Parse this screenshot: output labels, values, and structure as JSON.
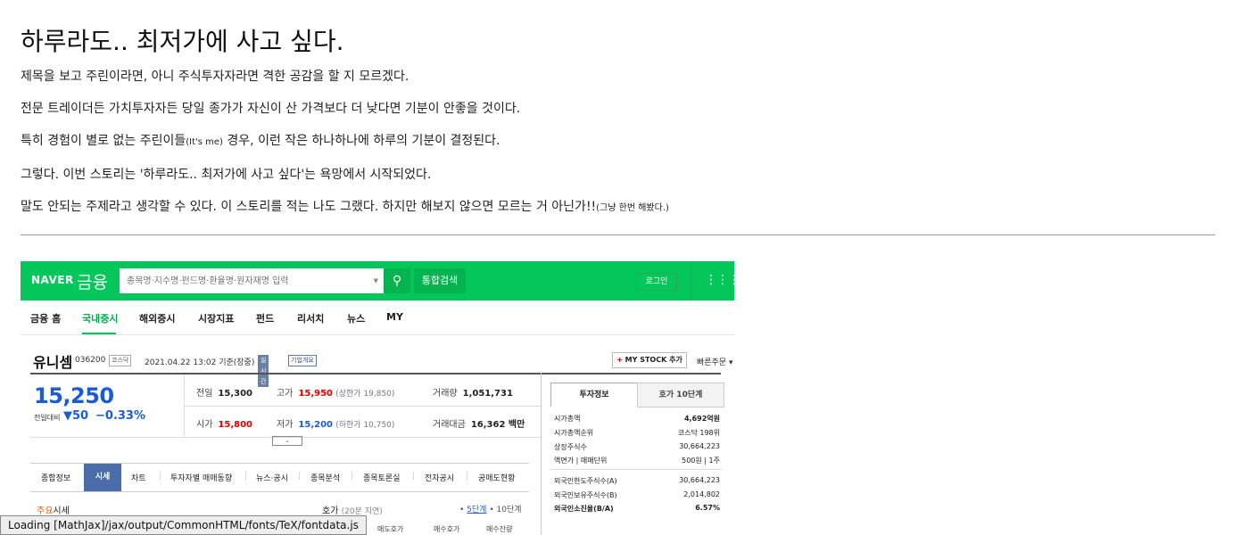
{
  "post": {
    "title": "하루라도.. 최저가에 사고 싶다.",
    "p1": "제목을 보고 주린이라면, 아니 주식투자자라면 격한 공감을 할 지 모르겠다.",
    "p2": "전문 트레이더든 가치투자자든 당일 종가가 자신이 산 가격보다 더 낮다면 기분이 안좋을 것이다.",
    "p3_a": "특히 경험이 별로 없는 주린이들",
    "p3_small": "(It's me)",
    "p3_b": " 경우, 이런 작은 하나하나에 하루의 기분이 결정된다.",
    "p4": "그렇다. 이번 스토리는 '하루라도.. 최저가에 사고 싶다'는 욕망에서 시작되었다.",
    "p5_a": "말도 안되는 주제라고 생각할 수 있다. 이 스토리를 적는 나도 그랬다. 하지만 해보지 않으면 모르는 거 아닌가!!",
    "p5_small": "(그냥 한번 해봤다.)"
  },
  "naver": {
    "logo": "NAVER",
    "service": "금융",
    "search_placeholder": "종목명·지수명·펀드명·환율명·원자재명 입력",
    "total_search": "통합검색",
    "login": "로그인",
    "gnb": [
      "금융 홈",
      "국내증시",
      "해외증시",
      "시장지표",
      "펀드",
      "리서치",
      "뉴스",
      "MY"
    ],
    "stock": {
      "name": "유니셈",
      "code": "036200",
      "market": "코스닥",
      "date": "2021.04.22 13:02 기준(장중)",
      "realtime": "실시간",
      "corp_info": "기업개요",
      "mystock": "MY STOCK 추가",
      "quick_order": "빠른주문",
      "price": "15,250",
      "change_label": "전일대비",
      "change_val": "▼50",
      "change_pct": "−0.33%",
      "prev_label": "전일",
      "prev": "15,300",
      "high_label": "고가",
      "high": "15,950",
      "upper": "(상한가 19,850)",
      "volume_label": "거래량",
      "volume": "1,051,731",
      "open_label": "시가",
      "open": "15,800",
      "low_label": "저가",
      "low": "15,200",
      "lower": "(하한가 10,750)",
      "amount_label": "거래대금",
      "amount": "16,362 백만"
    },
    "tabs": [
      "종합정보",
      "시세",
      "차트",
      "투자자별 매매동향",
      "뉴스·공시",
      "종목분석",
      "종목토론실",
      "전자공시",
      "공매도현황"
    ],
    "section": {
      "main_a": "주요",
      "main_b": "시세",
      "hoga": "호가",
      "hoga_note": "(20분 지연)",
      "step5": "5단계",
      "step10": "10단계",
      "col_headers": [
        "잔량",
        "매도호가",
        "매수호가",
        "매수잔량"
      ]
    },
    "right": {
      "tab1": "투자정보",
      "tab2": "호가 10단계",
      "rows": [
        {
          "label": "시가총액",
          "value": "4,692억원",
          "strong": true
        },
        {
          "label": "시가총액순위",
          "value": "코스닥 198위",
          "strong": false
        },
        {
          "label": "상장주식수",
          "value": "30,664,223",
          "strong": false
        },
        {
          "label": "액면가 | 매매단위",
          "value": "500원 | 1주",
          "strong": false
        },
        {
          "label": "외국인한도주식수(A)",
          "value": "30,664,223",
          "strong": false
        },
        {
          "label": "외국인보유주식수(B)",
          "value": "2,014,802",
          "strong": false
        },
        {
          "label": "외국인소진율(B/A)",
          "value": "6.57%",
          "strong": true
        }
      ]
    }
  },
  "status": "Loading [MathJax]/jax/output/CommonHTML/fonts/TeX/fontdata.js"
}
